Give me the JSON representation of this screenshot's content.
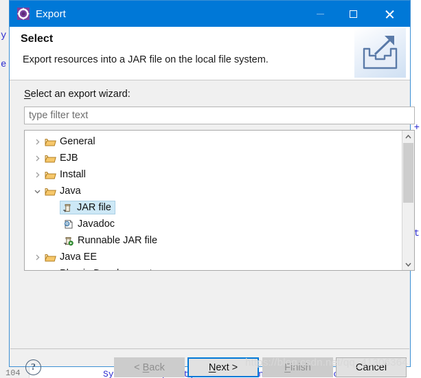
{
  "window": {
    "title": "Export",
    "icon": "export-gear-icon",
    "controls": {
      "minimize": "minimize-icon",
      "maximize": "maximize-icon",
      "close": "close-icon"
    },
    "accent_color": "#0078d7"
  },
  "header": {
    "title": "Select",
    "description": "Export resources into a JAR file on the local file system.",
    "icon": "export-tray-arrow-icon"
  },
  "body": {
    "wizard_label_mnemonic": "S",
    "wizard_label_rest": "elect an export wizard:",
    "filter": {
      "value": "",
      "placeholder": "type filter text"
    },
    "tree": {
      "items": [
        {
          "label": "General",
          "icon": "folder-icon",
          "level": 0,
          "expanded": false,
          "selected": false
        },
        {
          "label": "EJB",
          "icon": "folder-icon",
          "level": 0,
          "expanded": false,
          "selected": false
        },
        {
          "label": "Install",
          "icon": "folder-icon",
          "level": 0,
          "expanded": false,
          "selected": false
        },
        {
          "label": "Java",
          "icon": "folder-icon",
          "level": 0,
          "expanded": true,
          "selected": false
        },
        {
          "label": "JAR file",
          "icon": "jar-file-icon",
          "level": 1,
          "expanded": null,
          "selected": true
        },
        {
          "label": "Javadoc",
          "icon": "javadoc-icon",
          "level": 1,
          "expanded": null,
          "selected": false
        },
        {
          "label": "Runnable JAR file",
          "icon": "runnable-jar-icon",
          "level": 1,
          "expanded": null,
          "selected": false
        },
        {
          "label": "Java EE",
          "icon": "folder-icon",
          "level": 0,
          "expanded": false,
          "selected": false
        },
        {
          "label": "Plug-in Development",
          "icon": "folder-icon",
          "level": 0,
          "expanded": false,
          "selected": false
        }
      ],
      "scrollbar": {
        "up_arrow": "chevron-up-icon",
        "down_arrow": "chevron-down-icon"
      }
    }
  },
  "footer": {
    "help": "?",
    "buttons": {
      "back": {
        "pre": "< ",
        "mnemonic": "B",
        "post": "ack",
        "state": "disabled"
      },
      "next": {
        "pre": "",
        "mnemonic": "N",
        "post": "ext >",
        "state": "default"
      },
      "finish": {
        "pre": "",
        "mnemonic": "F",
        "post": "inish",
        "state": "disabled"
      },
      "cancel": {
        "pre": "",
        "mnemonic": "",
        "post": "Cancel",
        "state": "normal"
      }
    }
  },
  "watermark": "https://blog.csdn.net/qq_41306364",
  "background": {
    "left_fragment_1": "y",
    "left_fragment_2": "e",
    "right_fragment_1": "+",
    "right_fragment_2": "t",
    "line_number": "104",
    "code_pre": "System.",
    "code_bold": "out",
    "code_post": ".print(\"the shutdown has been cancelled"
  }
}
